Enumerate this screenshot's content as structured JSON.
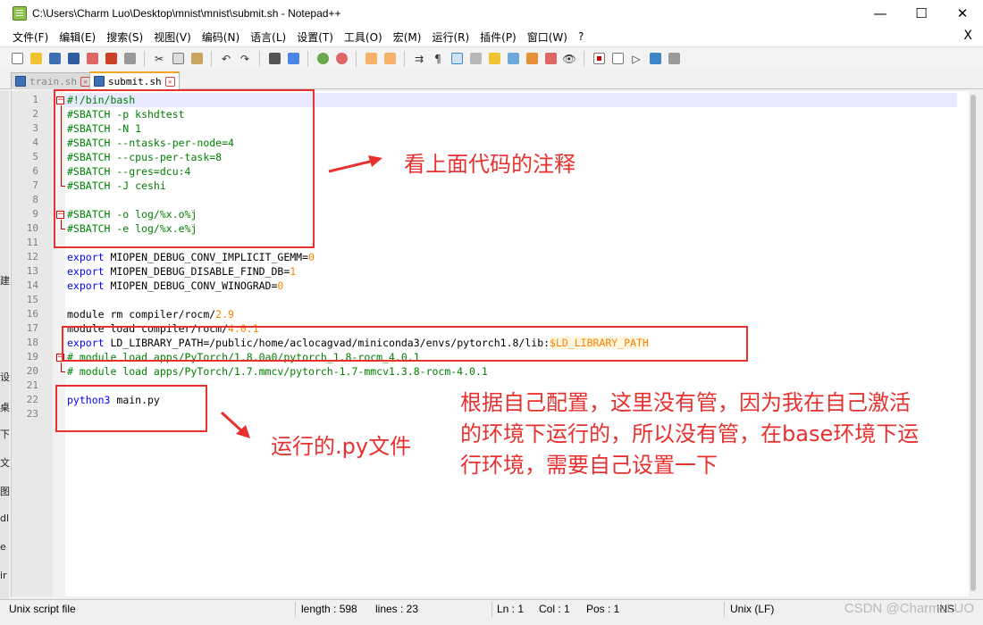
{
  "window": {
    "title": "C:\\Users\\Charm Luo\\Desktop\\mnist\\mnist\\submit.sh - Notepad++",
    "minimize": "—",
    "maximize": "☐",
    "close": "✕"
  },
  "menu": {
    "items": [
      "文件(F)",
      "编辑(E)",
      "搜索(S)",
      "视图(V)",
      "编码(N)",
      "语言(L)",
      "设置(T)",
      "工具(O)",
      "宏(M)",
      "运行(R)",
      "插件(P)",
      "窗口(W)",
      "?"
    ],
    "close_glyph": "X"
  },
  "tabs": [
    {
      "label": "train.sh",
      "active": false
    },
    {
      "label": "submit.sh",
      "active": true
    }
  ],
  "editor": {
    "line_numbers": [
      "1",
      "2",
      "3",
      "4",
      "5",
      "6",
      "7",
      "8",
      "9",
      "10",
      "11",
      "12",
      "13",
      "14",
      "15",
      "16",
      "17",
      "18",
      "19",
      "20",
      "21",
      "22",
      "23"
    ],
    "lines": [
      [
        {
          "cls": "c",
          "text": "#!/bin/bash"
        }
      ],
      [
        {
          "cls": "c",
          "text": "#SBATCH -p kshdtest"
        }
      ],
      [
        {
          "cls": "c",
          "text": "#SBATCH -N 1"
        }
      ],
      [
        {
          "cls": "c",
          "text": "#SBATCH --ntasks-per-node=4"
        }
      ],
      [
        {
          "cls": "c",
          "text": "#SBATCH --cpus-per-task=8"
        }
      ],
      [
        {
          "cls": "c",
          "text": "#SBATCH --gres=dcu:4"
        }
      ],
      [
        {
          "cls": "c",
          "text": "#SBATCH -J ceshi"
        }
      ],
      [],
      [
        {
          "cls": "c",
          "text": "#SBATCH -o log/%x.o%j"
        }
      ],
      [
        {
          "cls": "c",
          "text": "#SBATCH -e log/%x.e%j"
        }
      ],
      [],
      [
        {
          "cls": "k",
          "text": "export"
        },
        {
          "cls": "t",
          "text": " MIOPEN_DEBUG_CONV_IMPLICIT_GEMM="
        },
        {
          "cls": "n",
          "text": "0"
        }
      ],
      [
        {
          "cls": "k",
          "text": "export"
        },
        {
          "cls": "t",
          "text": " MIOPEN_DEBUG_DISABLE_FIND_DB="
        },
        {
          "cls": "n",
          "text": "1"
        }
      ],
      [
        {
          "cls": "k",
          "text": "export"
        },
        {
          "cls": "t",
          "text": " MIOPEN_DEBUG_CONV_WINOGRAD="
        },
        {
          "cls": "n",
          "text": "0"
        }
      ],
      [],
      [
        {
          "cls": "t",
          "text": "module rm compiler/rocm/"
        },
        {
          "cls": "n",
          "text": "2.9"
        }
      ],
      [
        {
          "cls": "t",
          "text": "module load compiler/rocm/"
        },
        {
          "cls": "n",
          "text": "4.0.1"
        }
      ],
      [
        {
          "cls": "k",
          "text": "export"
        },
        {
          "cls": "t",
          "text": " LD_LIBRARY_PATH=/public/home/aclocagvad/miniconda3/envs/pytorch1.8/lib:"
        },
        {
          "cls": "v",
          "text": "$LD_LIBRARY_PATH"
        }
      ],
      [
        {
          "cls": "c",
          "text": "# module load apps/PyTorch/1.8.0a0/pytorch_1.8-rocm_4.0.1"
        }
      ],
      [
        {
          "cls": "c",
          "text": "# module load apps/PyTorch/1.7.mmcv/pytorch-1.7-mmcv1.3.8-rocm-4.0.1"
        }
      ],
      [],
      [
        {
          "cls": "k",
          "text": "python3"
        },
        {
          "cls": "t",
          "text": " main.py"
        }
      ],
      []
    ]
  },
  "annotations": {
    "note1": "看上面代码的注释",
    "note2": "运行的.py文件",
    "note3_line1": "根据自己配置，这里没有管，因为我在自己激活",
    "note3_line2": "的环境下运行的，所以没有管，在base环境下运",
    "note3_line3": "行环境，需要自己设置一下"
  },
  "statusbar": {
    "filetype": "Unix script file",
    "length": "length : 598",
    "lines": "lines : 23",
    "ln": "Ln : 1",
    "col": "Col : 1",
    "pos": "Pos : 1",
    "eol": "Unix (LF)",
    "ins": "INS"
  },
  "watermark": "CSDN @CharmsLUO",
  "left_strip_chars": [
    "建",
    "设",
    "桌",
    "下",
    "文",
    "图",
    "dl",
    "e",
    "ir"
  ],
  "colors": {
    "annotation": "#e8312f",
    "comment": "#008000",
    "keyword": "#0000ff",
    "number": "#ff8000"
  }
}
